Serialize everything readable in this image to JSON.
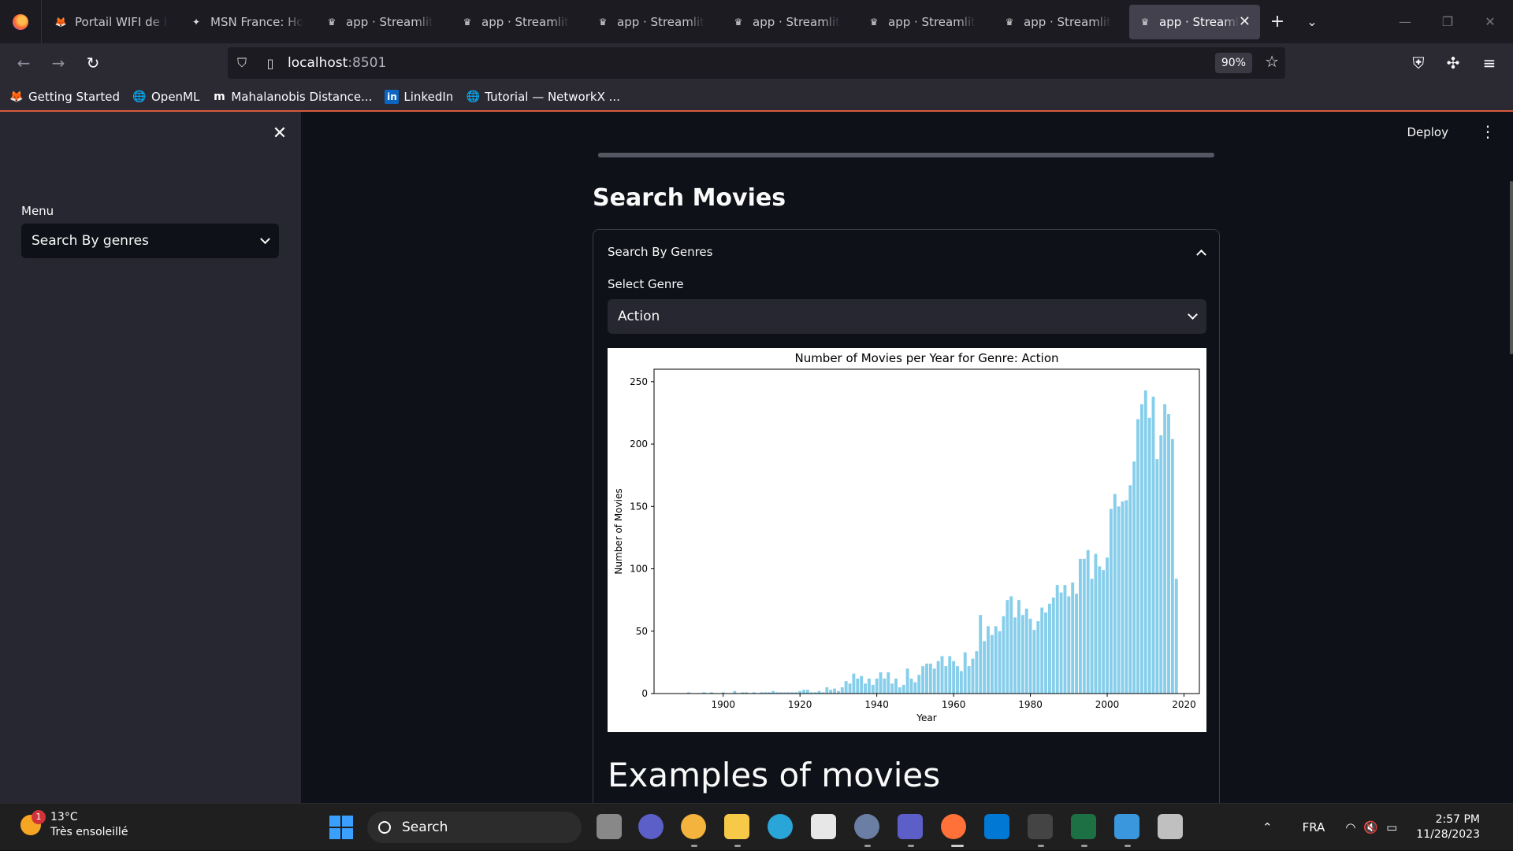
{
  "browser": {
    "tabs": [
      {
        "title": "Portail WIFI de l universi",
        "icon": "firefox-icon"
      },
      {
        "title": "MSN France: Hotmail",
        "icon": "msn-icon"
      },
      {
        "title": "app · Streamlit",
        "icon": "streamlit-icon"
      },
      {
        "title": "app · Streamlit",
        "icon": "streamlit-icon"
      },
      {
        "title": "app · Streamlit",
        "icon": "streamlit-icon"
      },
      {
        "title": "app · Streamlit",
        "icon": "streamlit-icon"
      },
      {
        "title": "app · Streamlit",
        "icon": "streamlit-icon"
      },
      {
        "title": "app · Streamlit",
        "icon": "streamlit-icon"
      },
      {
        "title": "app · Streamlit",
        "icon": "streamlit-icon",
        "active": true
      }
    ],
    "url_host": "localhost",
    "url_port": ":8501",
    "zoom": "90%",
    "bookmarks": [
      {
        "label": "Getting Started",
        "icon": "firefox-icon"
      },
      {
        "label": "OpenML",
        "icon": "globe-icon"
      },
      {
        "label": "Mahalanobis Distance...",
        "icon": "medium-icon"
      },
      {
        "label": "LinkedIn",
        "icon": "linkedin-icon"
      },
      {
        "label": "Tutorial — NetworkX ...",
        "icon": "globe-icon"
      }
    ]
  },
  "app": {
    "deploy_label": "Deploy",
    "sidebar": {
      "menu_label": "Menu",
      "menu_value": "Search By genres"
    },
    "progress": 1.0,
    "page_title": "Search Movies",
    "expander_title": "Search By Genres",
    "genre_label": "Select Genre",
    "genre_value": "Action",
    "examples_title": "Examples of movies"
  },
  "chart_data": {
    "type": "bar",
    "title": "Number of Movies per Year for Genre: Action",
    "xlabel": "Year",
    "ylabel": "Number of Movies",
    "xlim": [
      1882,
      2024
    ],
    "ylim": [
      0,
      260
    ],
    "xticks": [
      1900,
      1920,
      1940,
      1960,
      1980,
      2000,
      2020
    ],
    "yticks": [
      0,
      50,
      100,
      150,
      200,
      250
    ],
    "color": "#87ceeb",
    "x": [
      1891,
      1895,
      1897,
      1900,
      1903,
      1905,
      1906,
      1908,
      1910,
      1911,
      1912,
      1913,
      1914,
      1915,
      1916,
      1917,
      1918,
      1919,
      1920,
      1921,
      1922,
      1923,
      1924,
      1925,
      1926,
      1927,
      1928,
      1929,
      1930,
      1931,
      1932,
      1933,
      1934,
      1935,
      1936,
      1937,
      1938,
      1939,
      1940,
      1941,
      1942,
      1943,
      1944,
      1945,
      1946,
      1947,
      1948,
      1949,
      1950,
      1951,
      1952,
      1953,
      1954,
      1955,
      1956,
      1957,
      1958,
      1959,
      1960,
      1961,
      1962,
      1963,
      1964,
      1965,
      1966,
      1967,
      1968,
      1969,
      1970,
      1971,
      1972,
      1973,
      1974,
      1975,
      1976,
      1977,
      1978,
      1979,
      1980,
      1981,
      1982,
      1983,
      1984,
      1985,
      1986,
      1987,
      1988,
      1989,
      1990,
      1991,
      1992,
      1993,
      1994,
      1995,
      1996,
      1997,
      1998,
      1999,
      2000,
      2001,
      2002,
      2003,
      2004,
      2005,
      2006,
      2007,
      2008,
      2009,
      2010,
      2011,
      2012,
      2013,
      2014,
      2015,
      2016,
      2017,
      2018
    ],
    "values": [
      1,
      1,
      1,
      1,
      2,
      1,
      1,
      1,
      1,
      1,
      1,
      2,
      1,
      1,
      1,
      1,
      1,
      1,
      2,
      3,
      3,
      1,
      1,
      2,
      1,
      5,
      3,
      4,
      2,
      5,
      10,
      8,
      16,
      12,
      14,
      8,
      12,
      7,
      12,
      17,
      12,
      17,
      8,
      12,
      5,
      7,
      20,
      12,
      9,
      15,
      22,
      24,
      24,
      20,
      26,
      30,
      22,
      30,
      26,
      22,
      18,
      33,
      22,
      28,
      34,
      63,
      42,
      54,
      47,
      54,
      50,
      62,
      75,
      78,
      61,
      75,
      63,
      68,
      60,
      51,
      58,
      69,
      65,
      72,
      77,
      87,
      81,
      87,
      78,
      89,
      80,
      108,
      108,
      115,
      92,
      112,
      102,
      99,
      109,
      148,
      160,
      150,
      154,
      155,
      167,
      186,
      220,
      232,
      243,
      221,
      238,
      188,
      207,
      232,
      224,
      204,
      92,
      1
    ]
  }
}
